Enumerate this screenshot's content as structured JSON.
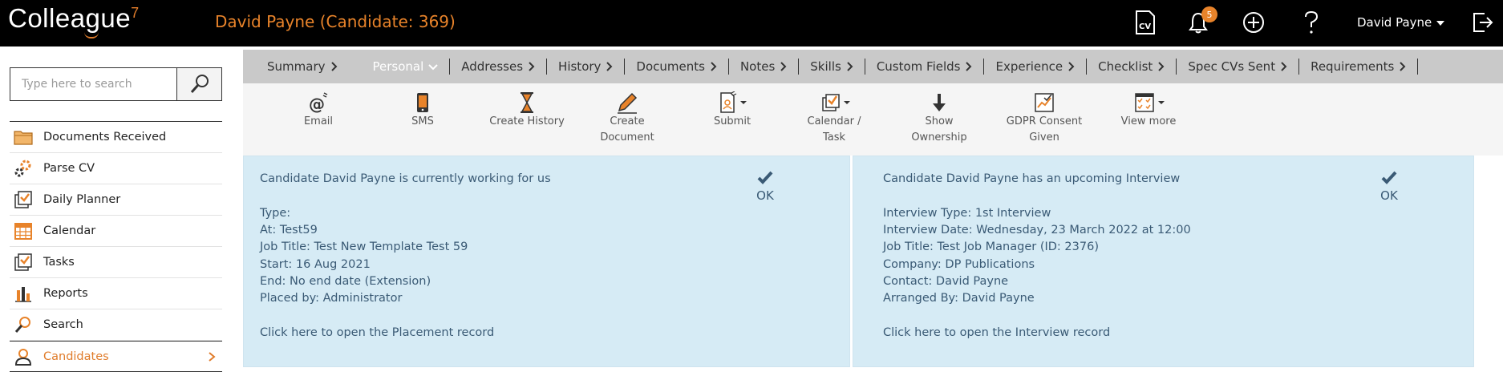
{
  "app": {
    "logo_text": "Colleague",
    "logo_version": "7",
    "page_title": "David Payne (Candidate: 369)",
    "notifications_count": "5",
    "user_name": "David Payne"
  },
  "topbar_icons": [
    "cv-icon",
    "bell-icon",
    "plus-circle-icon",
    "help-icon",
    "logout-icon"
  ],
  "search": {
    "placeholder": "Type here to search"
  },
  "sidebar": {
    "items": [
      {
        "label": "Documents Received",
        "icon": "folder-icon"
      },
      {
        "label": "Parse CV",
        "icon": "gears-icon"
      },
      {
        "label": "Daily Planner",
        "icon": "planner-icon"
      },
      {
        "label": "Calendar",
        "icon": "calendar-icon"
      },
      {
        "label": "Tasks",
        "icon": "tasks-icon"
      },
      {
        "label": "Reports",
        "icon": "reports-icon"
      },
      {
        "label": "Search",
        "icon": "search-icon"
      },
      {
        "label": "Candidates",
        "icon": "person-icon",
        "active": true
      }
    ]
  },
  "tabs": [
    {
      "label": "Summary"
    },
    {
      "label": "Personal",
      "active": true
    },
    {
      "label": "Addresses"
    },
    {
      "label": "History"
    },
    {
      "label": "Documents"
    },
    {
      "label": "Notes"
    },
    {
      "label": "Skills"
    },
    {
      "label": "Custom Fields"
    },
    {
      "label": "Experience"
    },
    {
      "label": "Checklist"
    },
    {
      "label": "Spec CVs Sent"
    },
    {
      "label": "Requirements"
    }
  ],
  "toolbar": {
    "email": "Email",
    "sms": "SMS",
    "create_history": "Create History",
    "create_document_1": "Create",
    "create_document_2": "Document",
    "submit": "Submit",
    "calendar_task_1": "Calendar /",
    "calendar_task_2": "Task",
    "show_ownership_1": "Show",
    "show_ownership_2": "Ownership",
    "gdpr_1": "GDPR Consent",
    "gdpr_2": "Given",
    "view_more": "View more"
  },
  "placement_panel": {
    "heading": "Candidate David Payne is currently working for us",
    "type": "Type:",
    "at": "At: Test59",
    "job_title": "Job Title: Test New Template Test 59",
    "start": "Start: 16 Aug 2021",
    "end": "End: No end date (Extension)",
    "placed_by": "Placed by: Administrator",
    "link": "Click here to open the Placement record",
    "ok": "OK"
  },
  "interview_panel": {
    "heading": "Candidate David Payne has an upcoming Interview",
    "interview_type": "Interview Type: 1st Interview",
    "interview_date": "Interview Date: Wednesday, 23 March 2022 at 12:00",
    "job_title": "Job Title: Test Job Manager (ID: 2376)",
    "company": "Company: DP Publications",
    "contact": "Contact: David Payne",
    "arranged_by": "Arranged By: David Payne",
    "link": "Click here to open the Interview record",
    "ok": "OK"
  },
  "colors": {
    "accent": "#e8832a",
    "panel_bg": "#d6ebf5",
    "panel_text": "#3a5a75",
    "tab_bar": "#c9c9c9"
  }
}
